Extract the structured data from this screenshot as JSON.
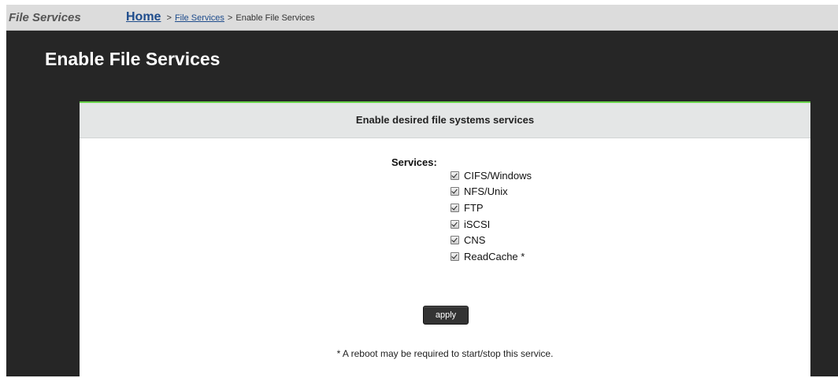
{
  "topbar": {
    "section_title": "File Services",
    "breadcrumb": {
      "home": "Home",
      "sep1": ">",
      "file_services": "File Services",
      "sep2": ">",
      "current": "Enable File Services"
    }
  },
  "page": {
    "title": "Enable File Services"
  },
  "panel": {
    "header": "Enable desired file systems services",
    "services_label": "Services:",
    "services": [
      {
        "label": "CIFS/Windows",
        "checked": true
      },
      {
        "label": "NFS/Unix",
        "checked": true
      },
      {
        "label": "FTP",
        "checked": true
      },
      {
        "label": "iSCSI",
        "checked": true
      },
      {
        "label": "CNS",
        "checked": true
      },
      {
        "label": "ReadCache *",
        "checked": true
      }
    ],
    "apply_label": "apply",
    "note": "* A reboot may be required to start/stop this service."
  },
  "colors": {
    "frame_bg": "#262626",
    "topbar_bg": "#dcdcdc",
    "panel_accent": "#69d34a",
    "link": "#1e4c8c"
  }
}
